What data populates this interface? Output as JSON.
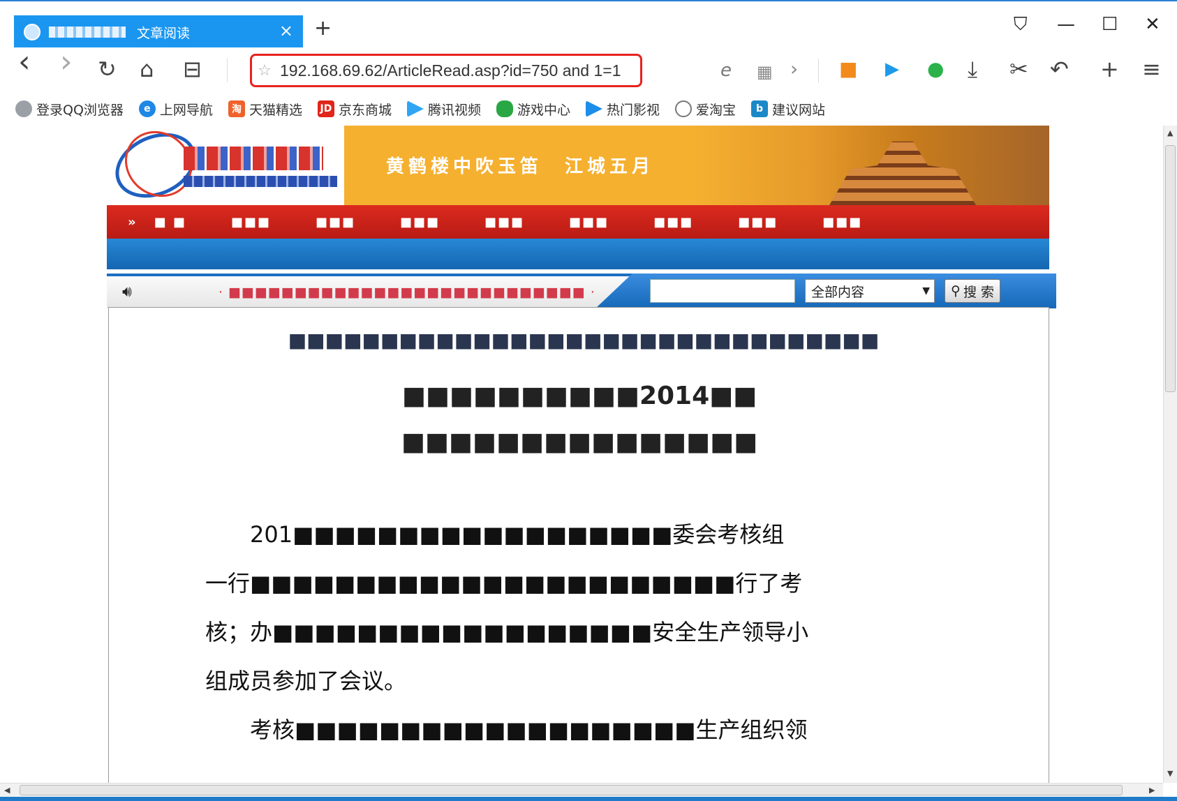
{
  "browser": {
    "tab": {
      "site_label": "",
      "title": "文章阅读",
      "close": "×"
    },
    "new_tab": "+",
    "window": {
      "pin": "⛉",
      "minimize": "—",
      "maximize": "☐",
      "close": "✕"
    },
    "toolbar": {
      "back": "‹",
      "forward": "›",
      "refresh": "↻",
      "home": "⌂",
      "reader": "⊟"
    },
    "url": "192.168.69.62/ArticleRead.asp?id=750 and 1=1",
    "right_tools": {
      "ie": "e",
      "qr": "▦",
      "more": "›",
      "video": "■",
      "play": "▶",
      "chat": "●",
      "download": "⤓",
      "cut": "✂",
      "undo": "↶",
      "plus": "+",
      "menu": "≡"
    },
    "bookmarks": [
      {
        "label": "登录QQ浏览器",
        "icon": "user-icon",
        "color": "#9aa0a6"
      },
      {
        "label": "上网导航",
        "icon": "ie-icon",
        "color": "#1e88e5"
      },
      {
        "label": "天猫精选",
        "icon": "tmall-icon",
        "color": "#f0622b"
      },
      {
        "label": "京东商城",
        "icon": "jd-icon",
        "color": "#e1251b"
      },
      {
        "label": "腾讯视频",
        "icon": "video-icon",
        "color": "#2fa5f4"
      },
      {
        "label": "游戏中心",
        "icon": "game-icon",
        "color": "#2aa745"
      },
      {
        "label": "热门影视",
        "icon": "play-icon",
        "color": "#1c8de8"
      },
      {
        "label": "爱淘宝",
        "icon": "globe-icon",
        "color": "#777777"
      },
      {
        "label": "建议网站",
        "icon": "bing-icon",
        "color": "#1b88c8"
      }
    ]
  },
  "page": {
    "slogan": "黄鹤楼中吹玉笛　江城五月",
    "nav": [
      "»",
      "■ ■",
      "■■■",
      "■■■",
      "■■■",
      "■■■",
      "■■■",
      "■■■",
      "■■■",
      "■■■"
    ],
    "ticker": "·  ■■■■■■■■■■■■■■■■■■■■■■■■■■■  ·",
    "search": {
      "scope": "全部内容",
      "button": "搜 索"
    },
    "article": {
      "subtitle": "■■■■■■■■■■■■■■■■■■■■■■■■■■■■■■■■",
      "title1": "■■■■■■■■■■2014■■",
      "title2": "■■■■■■■■■■■■■■■",
      "paragraphs": [
        "　　201■■■■■■■■■■■■■■■■■■委会考核组",
        "一行■■■■■■■■■■■■■■■■■■■■■■■行了考",
        "核；办■■■■■■■■■■■■■■■■■■安全生产领导小",
        "组成员参加了会议。",
        "　　考核■■■■■■■■■■■■■■■■■■■生产组织领"
      ]
    }
  }
}
